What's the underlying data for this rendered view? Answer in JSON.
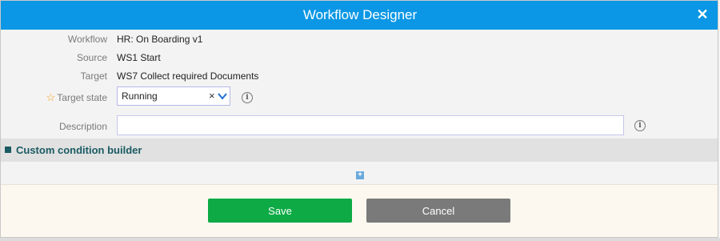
{
  "dialog": {
    "title": "Workflow Designer",
    "close_symbol": "✕"
  },
  "fields": {
    "workflow": {
      "label": "Workflow",
      "value": "HR: On Boarding v1"
    },
    "source": {
      "label": "Source",
      "value": "WS1 Start"
    },
    "target": {
      "label": "Target",
      "value": "WS7 Collect required Documents"
    },
    "target_state": {
      "label": "Target state",
      "value": "Running",
      "required": true
    },
    "description": {
      "label": "Description",
      "value": "",
      "placeholder": ""
    }
  },
  "section": {
    "title": "Custom condition builder"
  },
  "buttons": {
    "save": "Save",
    "cancel": "Cancel"
  },
  "colors": {
    "titlebar": "#0b97e5",
    "save": "#0daa46",
    "cancel": "#7a7a7a",
    "section_text": "#1a5b63",
    "required_star": "#f39c12"
  },
  "icons": {
    "close": "close-icon",
    "info": "info-icon",
    "clear": "clear-icon",
    "chevron": "chevron-down-icon",
    "add": "add-icon",
    "required": "star-icon"
  }
}
